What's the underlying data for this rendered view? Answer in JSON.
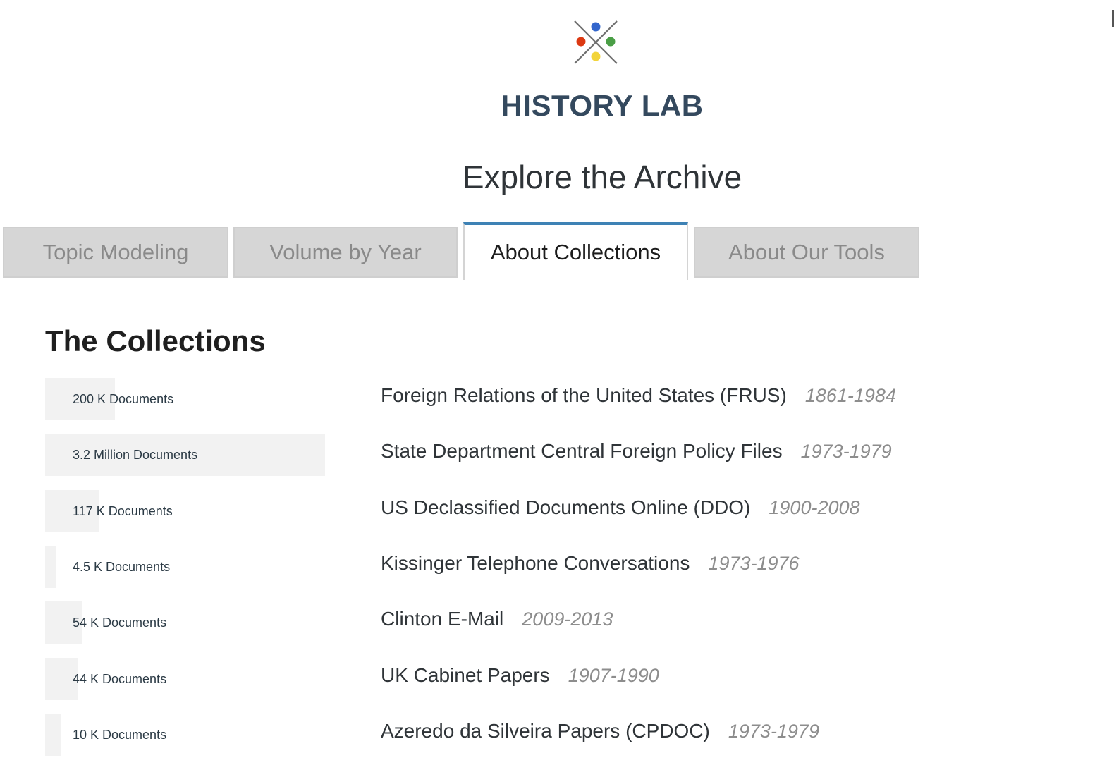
{
  "header": {
    "brand": "HISTORY LAB",
    "logo_icon": "x-cross-with-colored-dots-icon",
    "logo_dot_colors": [
      "#3366cc",
      "#dc3912",
      "#4a9e46",
      "#f2d43a"
    ],
    "title": "Explore the Archive"
  },
  "tabs": [
    {
      "label": "Topic Modeling",
      "active": false
    },
    {
      "label": "Volume by Year",
      "active": false
    },
    {
      "label": "About Collections",
      "active": true
    },
    {
      "label": "About Our Tools",
      "active": false
    }
  ],
  "colors": {
    "active_tab_accent": "#3e82b5",
    "inactive_tab_bg": "#d6d6d6",
    "bar_fill": "#f2f2f2",
    "brand_text": "#34495e"
  },
  "collections": {
    "heading": "The Collections",
    "items": [
      {
        "count_label": "200 K Documents",
        "documents": 200000,
        "name": "Foreign Relations of the United States (FRUS)",
        "years": "1861-1984"
      },
      {
        "count_label": "3.2 Million Documents",
        "documents": 3200000,
        "name": "State Department Central Foreign Policy Files",
        "years": "1973-1979"
      },
      {
        "count_label": "117 K Documents",
        "documents": 117000,
        "name": "US Declassified Documents Online (DDO)",
        "years": "1900-2008"
      },
      {
        "count_label": "4.5 K Documents",
        "documents": 4500,
        "name": "Kissinger Telephone Conversations",
        "years": "1973-1976"
      },
      {
        "count_label": "54 K Documents",
        "documents": 54000,
        "name": "Clinton E-Mail",
        "years": "2009-2013"
      },
      {
        "count_label": "44 K Documents",
        "documents": 44000,
        "name": "UK Cabinet Papers",
        "years": "1907-1990"
      },
      {
        "count_label": "10 K Documents",
        "documents": 10000,
        "name": "Azeredo da Silveira Papers (CPDOC)",
        "years": "1973-1979"
      }
    ]
  }
}
